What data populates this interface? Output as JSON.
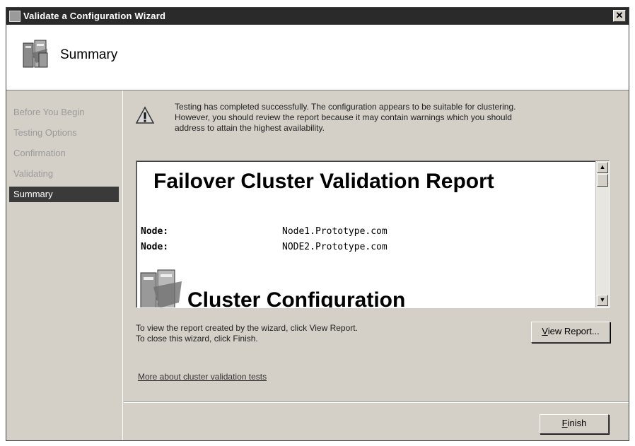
{
  "window": {
    "title": "Validate a Configuration Wizard",
    "close_glyph": "✕"
  },
  "header": {
    "title": "Summary"
  },
  "nav": {
    "items": [
      {
        "label": "Before You Begin"
      },
      {
        "label": "Testing Options"
      },
      {
        "label": "Confirmation"
      },
      {
        "label": "Validating"
      },
      {
        "label": "Summary",
        "active": true
      }
    ]
  },
  "message": {
    "line1": "Testing has completed successfully. The configuration appears to be suitable for clustering.",
    "line2": "However, you should review the report because it may contain warnings which you should",
    "line3": "address to attain the highest availability."
  },
  "report": {
    "title": "Failover Cluster Validation Report",
    "rows": [
      {
        "key": "Node:",
        "value": "Node1.Prototype.com"
      },
      {
        "key": "Node:",
        "value": "NODE2.Prototype.com"
      }
    ],
    "section_partial": "Cluster Configuration"
  },
  "info": {
    "line1": "To view the report created by the wizard, click View Report.",
    "line2": "To close this wizard, click Finish."
  },
  "buttons": {
    "view_report_mnemonic": "V",
    "view_report_rest": "iew Report...",
    "finish_mnemonic": "F",
    "finish_rest": "inish"
  },
  "link": {
    "label": "More about cluster validation tests"
  },
  "icons": {
    "wizard": "cluster-wizard-icon",
    "warning": "warning-icon",
    "scroll_up": "▲",
    "scroll_down": "▼"
  }
}
